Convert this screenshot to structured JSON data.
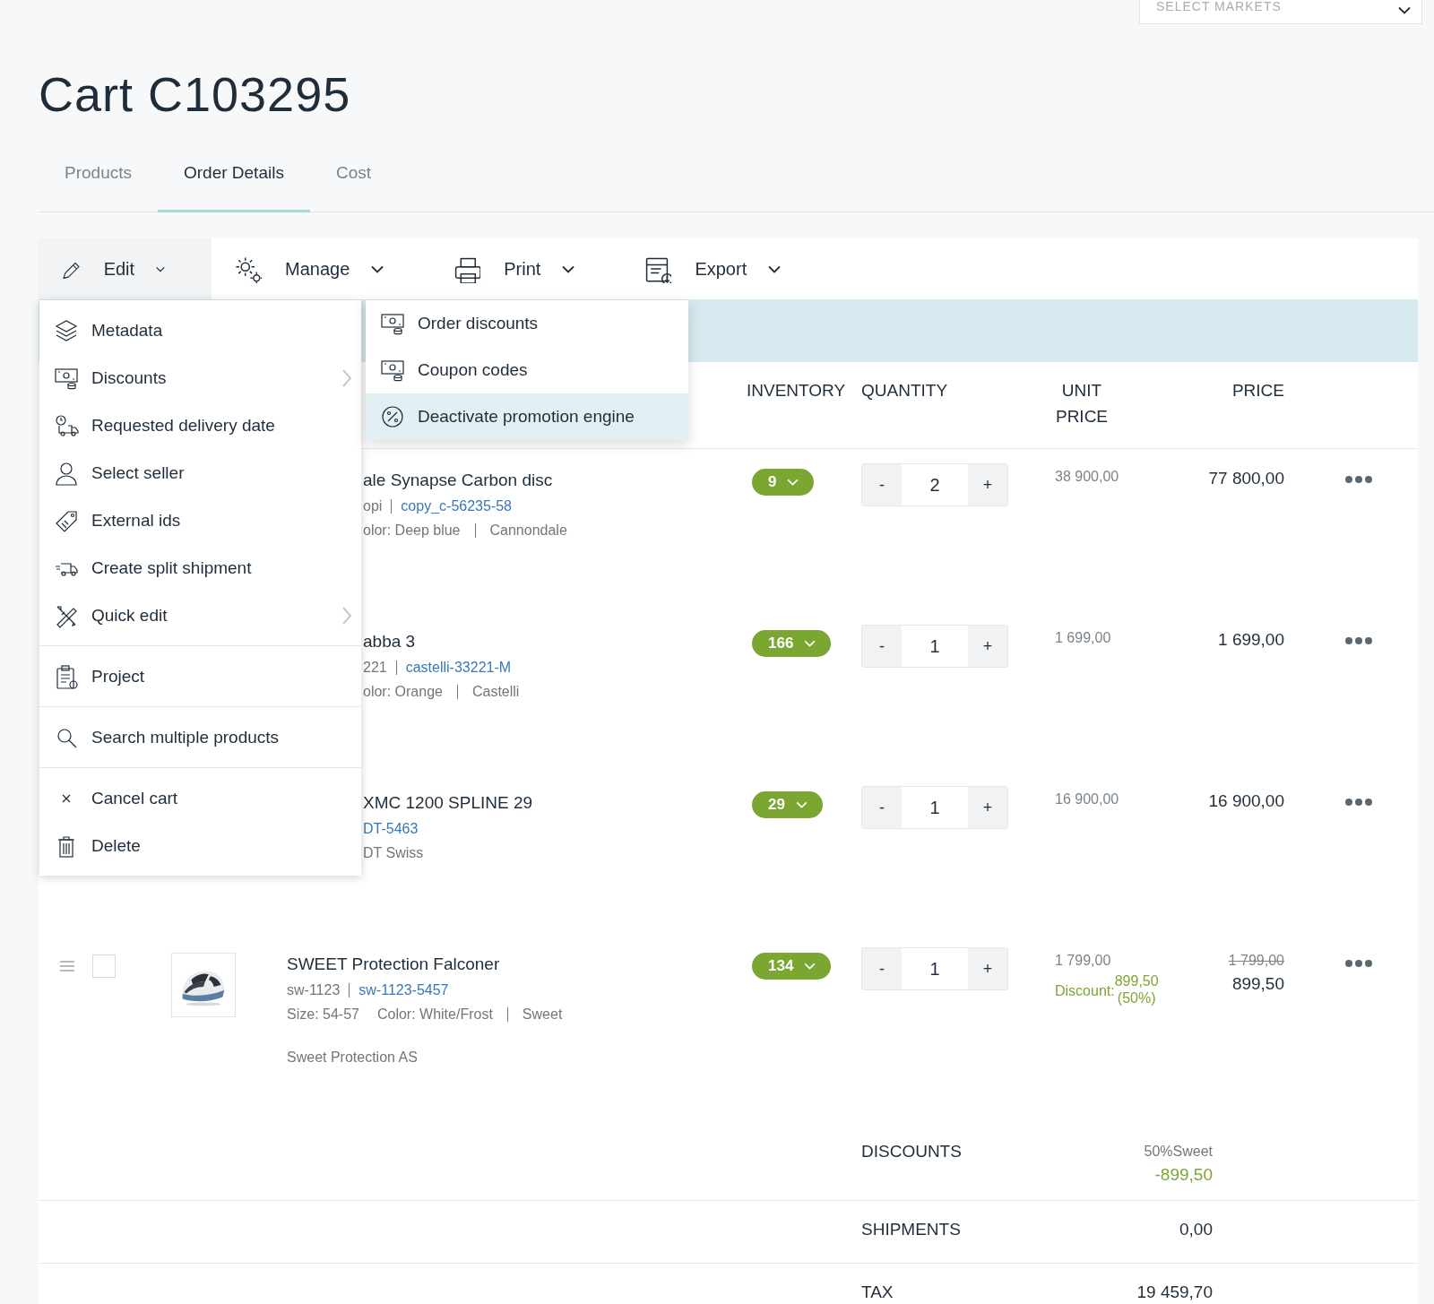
{
  "market_select": {
    "placeholder": "SELECT MARKETS"
  },
  "title": "Cart C103295",
  "tabs": [
    {
      "label": "Products",
      "selected": false
    },
    {
      "label": "Order Details",
      "selected": true
    },
    {
      "label": "Cost",
      "selected": false
    }
  ],
  "toolbar": [
    {
      "label": "Edit",
      "open": true
    },
    {
      "label": "Manage",
      "open": false
    },
    {
      "label": "Print",
      "open": false
    },
    {
      "label": "Export",
      "open": false
    }
  ],
  "edit_menu": {
    "groups": [
      [
        {
          "label": "Metadata",
          "submenu": false
        },
        {
          "label": "Discounts",
          "submenu": true
        },
        {
          "label": "Requested delivery date",
          "submenu": false
        },
        {
          "label": "Select seller",
          "submenu": false
        },
        {
          "label": "External ids",
          "submenu": false
        },
        {
          "label": "Create split shipment",
          "submenu": false
        },
        {
          "label": "Quick edit",
          "submenu": true
        }
      ],
      [
        {
          "label": "Project",
          "submenu": false
        }
      ],
      [
        {
          "label": "Search multiple products",
          "submenu": false
        }
      ],
      [
        {
          "label": "Cancel cart",
          "submenu": false
        },
        {
          "label": "Delete",
          "submenu": false
        }
      ]
    ]
  },
  "discounts_submenu": {
    "items": [
      {
        "label": "Order discounts",
        "selected": false
      },
      {
        "label": "Coupon codes",
        "selected": false
      },
      {
        "label": "Deactivate promotion engine",
        "selected": true
      }
    ]
  },
  "table": {
    "columns": [
      {
        "label": "INVENTORY",
        "kind": "inventory"
      },
      {
        "label": "QUANTITY",
        "kind": "quantity"
      },
      {
        "label": "UNIT PRICE",
        "kind": "unit"
      },
      {
        "label": "PRICE",
        "kind": "price"
      }
    ],
    "rows": [
      {
        "name": "ale Synapse Carbon disc",
        "sku": "opi",
        "variant_id": "copy_c-56235-58",
        "attributes": [
          "olor: Deep blue",
          "Cannondale"
        ],
        "inventory": "9",
        "minus": "-",
        "quantity": "2",
        "plus": "+",
        "unit_price": "38 900,00",
        "price": "77 800,00"
      },
      {
        "name": "abba 3",
        "sku": "221",
        "variant_id": "castelli-33221-M",
        "attributes": [
          "olor: Orange",
          "Castelli"
        ],
        "inventory": "166",
        "minus": "-",
        "quantity": "1",
        "plus": "+",
        "unit_price": "1 699,00",
        "price": "1 699,00"
      },
      {
        "name": "XMC 1200 SPLINE 29",
        "variant_id": "DT-5463",
        "attributes": [
          "DT Swiss"
        ],
        "inventory": "29",
        "minus": "-",
        "quantity": "1",
        "plus": "+",
        "unit_price": "16 900,00",
        "price": "16 900,00"
      },
      {
        "name": "SWEET Protection Falconer",
        "selected": false,
        "image": {
          "kind": "picture"
        },
        "sku": "sw-1123",
        "variant_id": "sw-1123-5457",
        "attributes": [
          "Size: 54-57",
          "Color: White/Frost",
          "Sweet"
        ],
        "supplier": "Sweet Protection AS",
        "inventory": "134",
        "minus": "-",
        "quantity": "1",
        "plus": "+",
        "unit_price": "1 799,00",
        "discount": {
          "label": "Discount:",
          "amount": "899,50",
          "percent": "(50%)"
        },
        "original_price": "1 799,00",
        "price": "899,50"
      }
    ]
  },
  "summary": [
    {
      "label": "DISCOUNTS",
      "note": "50%Sweet",
      "value": "-899,50",
      "kind": "discount"
    },
    {
      "label": "SHIPMENTS",
      "value": "0,00",
      "kind": "plain"
    },
    {
      "label": "TAX",
      "value": "19 459,70",
      "kind": "plain"
    }
  ]
}
